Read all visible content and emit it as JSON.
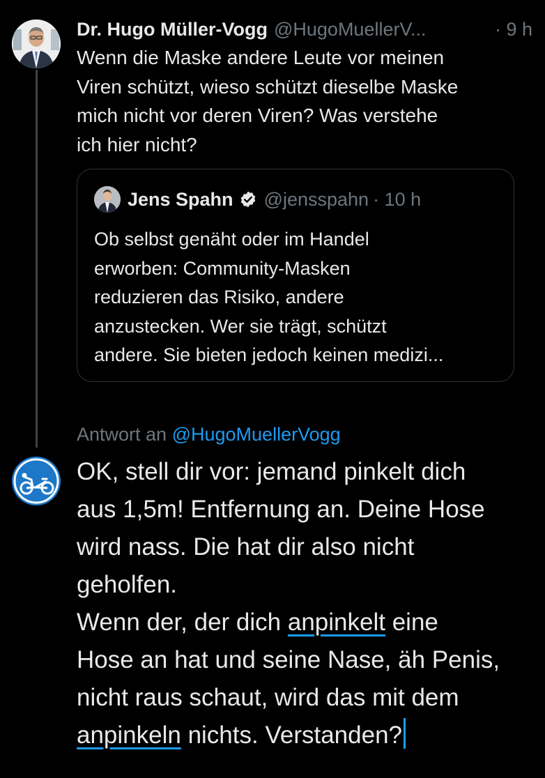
{
  "tweet": {
    "author_name": "Dr. Hugo Müller-Vogg",
    "author_handle": "@HugoMuellerV...",
    "time": "· 9 h",
    "text": "Wenn die Maske andere Leute vor meinen\nViren schützt, wieso schützt dieselbe Maske\nmich nicht vor deren Viren? Was verstehe\nich hier nicht?"
  },
  "quote": {
    "author_name": "Jens Spahn",
    "author_handle": "@jensspahn",
    "time": "· 10 h",
    "text": "Ob selbst genäht oder im Handel\nerworben: Community-Masken\nreduzieren das Risiko, andere\nanzustecken. Wer sie trägt, schützt\nandere. Sie bieten jedoch keinen medizi..."
  },
  "reply": {
    "reply_to_label": "Antwort an",
    "reply_to_handle": "@HugoMuellerVogg",
    "line1": "OK, stell dir vor: jemand pinkelt dich",
    "line2": "aus 1,5m! Entfernung an. Deine Hose",
    "line3": "wird nass. Die hat dir also nicht",
    "line4": "geholfen.",
    "line5_pre": "Wenn der, der dich ",
    "line5_underlined": "anpinkelt",
    "line5_post": " eine",
    "line6": "Hose an hat und seine Nase, äh Penis,",
    "line7": "nicht raus schaut, wird das mit dem",
    "line8_underlined": "anpinkeln",
    "line8_post": " nichts. Verstanden?"
  },
  "icons": {
    "verified": "verified-badge-icon",
    "reply_avatar": "recumbent-bicycle-sign-icon"
  },
  "colors": {
    "background": "#000000",
    "text": "#e7e9ea",
    "muted": "#6e767d",
    "accent": "#1d9bf0",
    "sign_blue": "#1d78c8"
  }
}
